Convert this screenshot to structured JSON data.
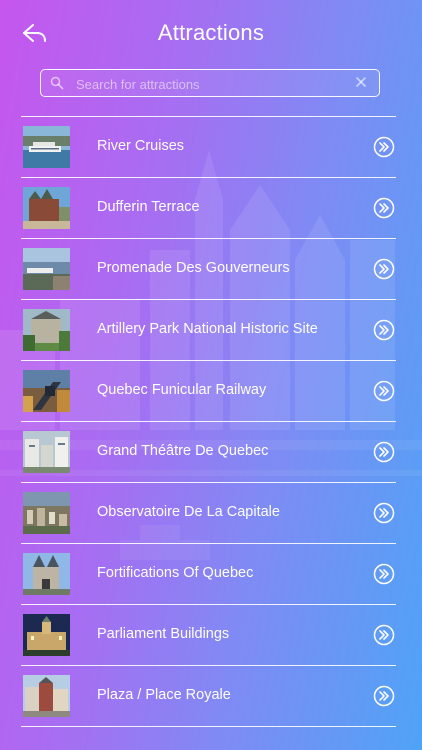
{
  "header": {
    "title": "Attractions",
    "back_icon": "back-arrow-icon"
  },
  "search": {
    "placeholder": "Search for attractions",
    "value": "",
    "search_icon": "magnifier-icon",
    "clear_icon": "close-icon"
  },
  "attractions": [
    {
      "name": "River Cruises",
      "thumb": "river-cruise-thumbnail"
    },
    {
      "name": "Dufferin Terrace",
      "thumb": "chateau-terrace-thumbnail"
    },
    {
      "name": "Promenade Des Gouverneurs",
      "thumb": "promenade-thumbnail"
    },
    {
      "name": "Artillery Park National Historic Site",
      "thumb": "artillery-park-thumbnail"
    },
    {
      "name": "Quebec Funicular Railway",
      "thumb": "funicular-thumbnail"
    },
    {
      "name": "Grand Théâtre De Quebec",
      "thumb": "theatre-thumbnail"
    },
    {
      "name": "Observatoire De La Capitale",
      "thumb": "observatory-thumbnail"
    },
    {
      "name": "Fortifications Of Quebec",
      "thumb": "fortifications-thumbnail"
    },
    {
      "name": "Parliament Buildings",
      "thumb": "parliament-thumbnail"
    },
    {
      "name": "Plaza / Place Royale",
      "thumb": "place-royale-thumbnail"
    }
  ],
  "row_action_icon": "double-chevron-right-icon",
  "colors": {
    "gradient_left": "#c656ee",
    "gradient_right": "#4fa3f6",
    "text": "#ffffff"
  }
}
